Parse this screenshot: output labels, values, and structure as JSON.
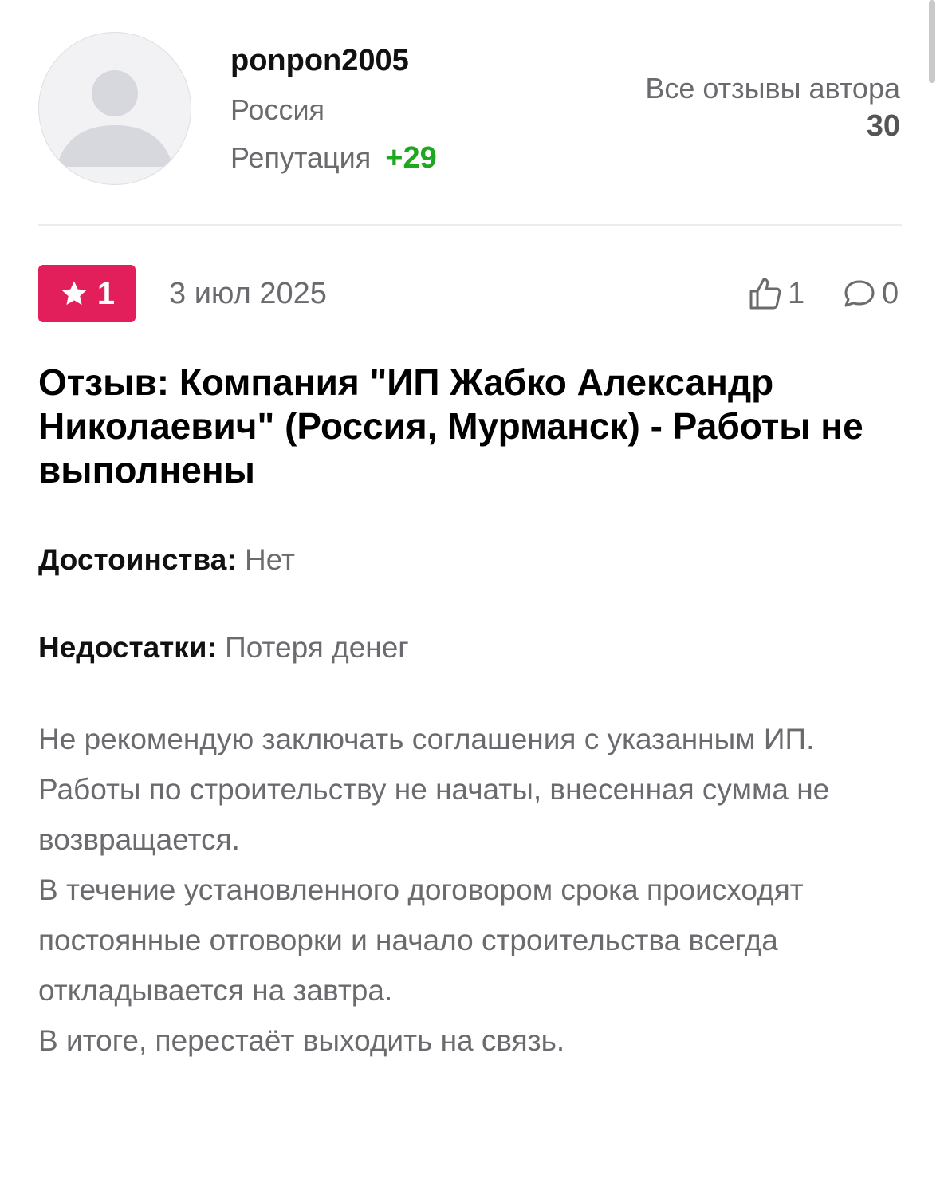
{
  "author": {
    "username": "ponpon2005",
    "country": "Россия",
    "reputation_label": "Репутация",
    "reputation_value": "+29",
    "all_reviews_label": "Все отзывы автора",
    "all_reviews_count": "30"
  },
  "review": {
    "rating": "1",
    "date": "3 июл 2025",
    "likes": "1",
    "comments": "0",
    "title": "Отзыв: Компания \"ИП Жабко Александр Николаевич\" (Россия, Мурманск) - Работы не выполнены",
    "pros_label": "Достоинства:",
    "pros_value": "Нет",
    "cons_label": "Недостатки:",
    "cons_value": "Потеря денег",
    "body": [
      "Не рекомендую заключать соглашения с указанным ИП.",
      "Работы по строительству не начаты, внесенная сумма не возвращается.",
      "В течение установленного договором срока происходят постоянные отговорки и начало строительства всегда откладывается на завтра.",
      "В итоге, перестаёт выходить на связь."
    ]
  },
  "colors": {
    "rating_badge": "#e21f5a",
    "reputation_positive": "#1fa71f",
    "muted_text": "#6b6b6f"
  },
  "icons": [
    "avatar-placeholder-icon",
    "star-icon",
    "thumbs-up-icon",
    "comment-icon"
  ]
}
